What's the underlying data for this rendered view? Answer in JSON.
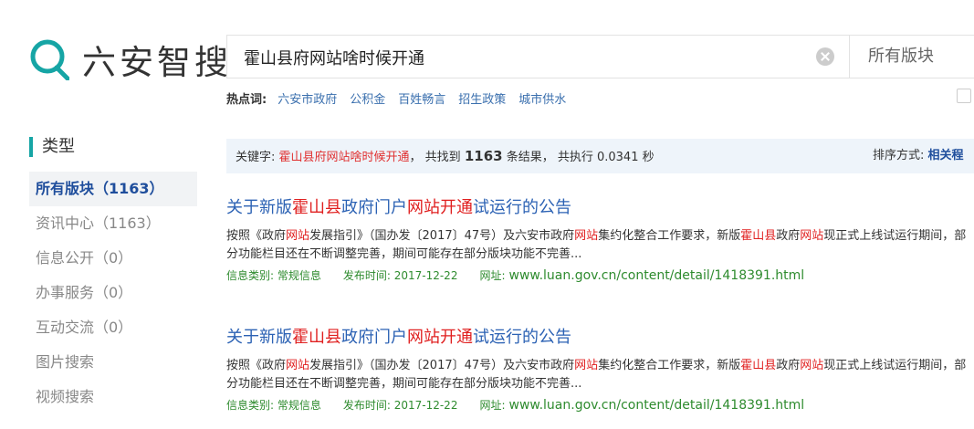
{
  "logo": {
    "text": "六安智搜",
    "icon": "search-q-icon",
    "color": "#16a5a5"
  },
  "search": {
    "value": "霍山县府网站啥时候开通",
    "scope": "所有版块"
  },
  "hotwords": {
    "label": "热点词:",
    "items": [
      "六安市政府",
      "公积金",
      "百姓畅言",
      "招生政策",
      "城市供水"
    ]
  },
  "sidebar": {
    "title": "类型",
    "items": [
      {
        "label": "所有版块（1163）"
      },
      {
        "label": "资讯中心（1163）"
      },
      {
        "label": "信息公开（0）"
      },
      {
        "label": "办事服务（0）"
      },
      {
        "label": "互动交流（0）"
      },
      {
        "label": "图片搜索"
      },
      {
        "label": "视频搜索"
      }
    ]
  },
  "infobar": {
    "kw_label": "关键字:",
    "keyword": "霍山县府网站啥时候开通",
    "found_prefix": "，  共找到",
    "count": "1163",
    "found_suffix": "条结果，  共执行 0.0341 秒",
    "sort_label": "排序方式:",
    "sort_value": "相关程"
  },
  "results": [
    {
      "title_parts": [
        "关于新版",
        "霍山县",
        "政府门户",
        "网站开通",
        "试运行的公告"
      ],
      "snippet_parts": [
        "按照《政府",
        "网站",
        "发展指引》（国办发〔2017〕47号）及六安市政府",
        "网站",
        "集约化整合工作要求，新版",
        "霍山县",
        "政府",
        "网站",
        "现正式上线试运行期间，部分功能栏目还在不断调整完善，期间可能存在部分版块功能不完善..."
      ],
      "category": "信息类别: 常规信息",
      "date": "发布时间: 2017-12-22",
      "url_label": "网址:",
      "url": "www.luan.gov.cn/content/detail/1418391.html"
    },
    {
      "title_parts": [
        "关于新版",
        "霍山县",
        "政府门户",
        "网站开通",
        "试运行的公告"
      ],
      "snippet_parts": [
        "按照《政府",
        "网站",
        "发展指引》（国办发〔2017〕47号）及六安市政府",
        "网站",
        "集约化整合工作要求，新版",
        "霍山县",
        "政府",
        "网站",
        "现正式上线试运行期间，部分功能栏目还在不断调整完善，期间可能存在部分版块功能不完善..."
      ],
      "category": "信息类别: 常规信息",
      "date": "发布时间: 2017-12-22",
      "url_label": "网址:",
      "url": "www.luan.gov.cn/content/detail/1418391.html"
    }
  ]
}
